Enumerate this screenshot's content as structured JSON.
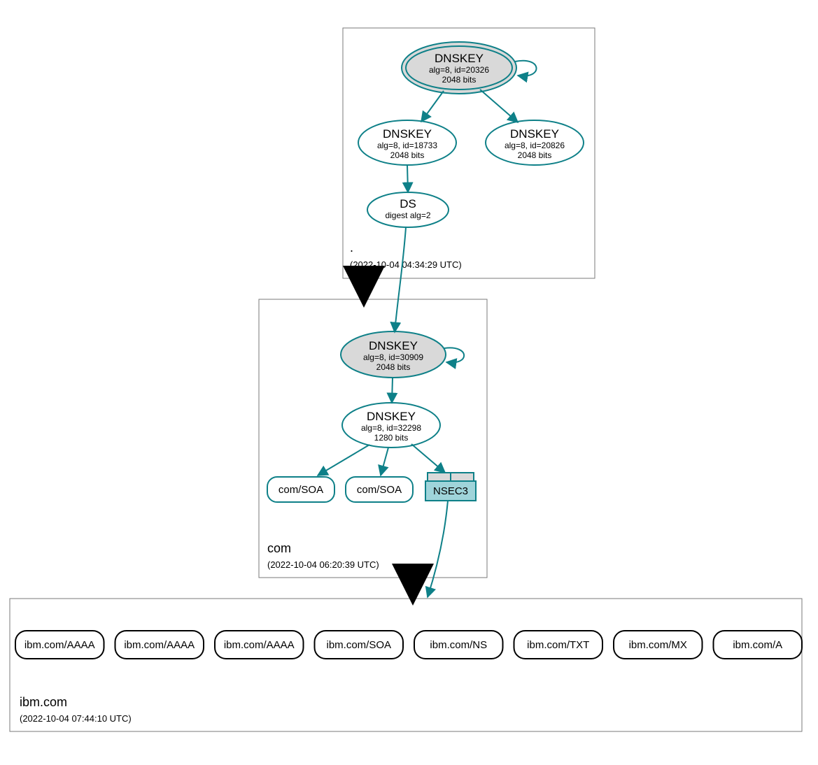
{
  "colors": {
    "teal": "#0E8088",
    "black": "#000000",
    "grayFill": "#d9d9d9",
    "nsecFill": "#9fd4da",
    "white": "#ffffff"
  },
  "zones": {
    "root": {
      "label": ".",
      "timestamp": "(2022-10-04 04:34:29 UTC)"
    },
    "com": {
      "label": "com",
      "timestamp": "(2022-10-04 06:20:39 UTC)"
    },
    "leaf": {
      "label": "ibm.com",
      "timestamp": "(2022-10-04 07:44:10 UTC)"
    }
  },
  "nodes": {
    "root_ksk": {
      "title": "DNSKEY",
      "sub1": "alg=8, id=20326",
      "sub2": "2048 bits"
    },
    "root_zsk": {
      "title": "DNSKEY",
      "sub1": "alg=8, id=18733",
      "sub2": "2048 bits"
    },
    "root_k3": {
      "title": "DNSKEY",
      "sub1": "alg=8, id=20826",
      "sub2": "2048 bits"
    },
    "root_ds": {
      "title": "DS",
      "sub1": "digest alg=2"
    },
    "com_ksk": {
      "title": "DNSKEY",
      "sub1": "alg=8, id=30909",
      "sub2": "2048 bits"
    },
    "com_zsk": {
      "title": "DNSKEY",
      "sub1": "alg=8, id=32298",
      "sub2": "1280 bits"
    },
    "com_soa1": {
      "label": "com/SOA"
    },
    "com_soa2": {
      "label": "com/SOA"
    },
    "com_nsec3": {
      "label": "NSEC3"
    },
    "leaf_recs": [
      "ibm.com/AAAA",
      "ibm.com/AAAA",
      "ibm.com/AAAA",
      "ibm.com/SOA",
      "ibm.com/NS",
      "ibm.com/TXT",
      "ibm.com/MX",
      "ibm.com/A"
    ]
  }
}
